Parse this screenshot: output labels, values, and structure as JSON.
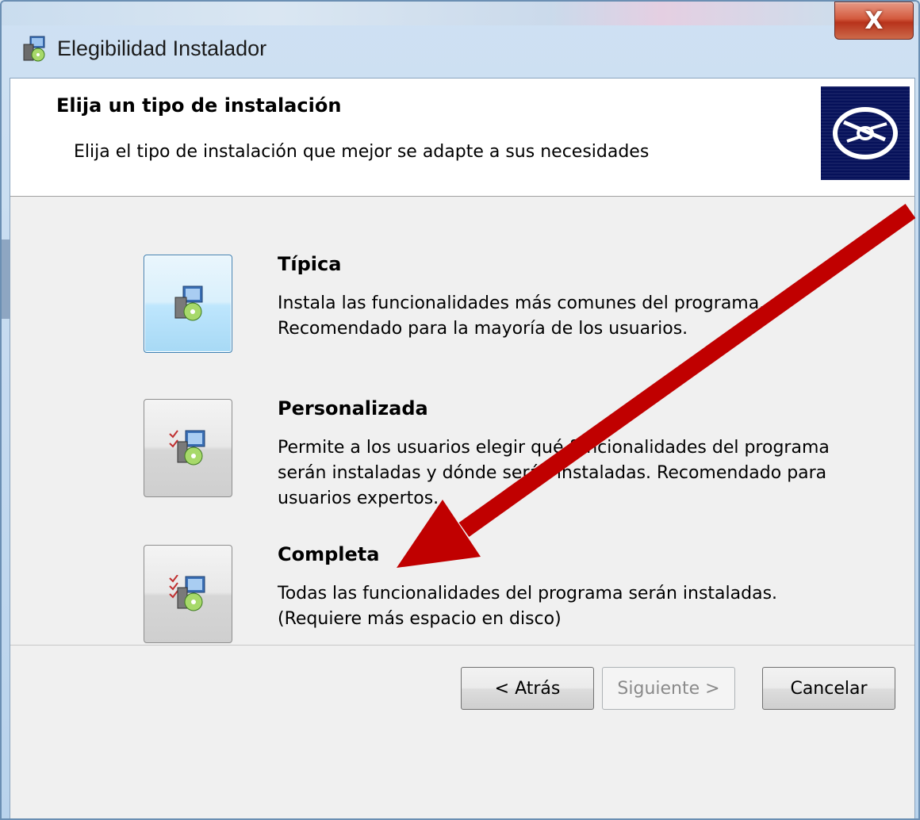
{
  "window": {
    "title": "Elegibilidad Instalador",
    "close_label": "X"
  },
  "header": {
    "title": "Elija un tipo de instalación",
    "subtitle": "Elija el tipo de instalación que mejor se adapte a sus necesidades"
  },
  "options": [
    {
      "title": "Típica",
      "description": "Instala las funcionalidades más comunes del programa. Recomendado para la mayoría de los usuarios."
    },
    {
      "title": "Personalizada",
      "description": "Permite a los usuarios elegir qué funcionalidades del programa serán instaladas y dónde serán instaladas. Recomendado para usuarios expertos."
    },
    {
      "title": "Completa",
      "description": "Todas las funcionalidades del programa serán instaladas. (Requiere más espacio en disco)"
    }
  ],
  "buttons": {
    "back": "< Atrás",
    "next": "Siguiente >",
    "cancel": "Cancelar"
  },
  "colors": {
    "annotation_arrow": "#c00000",
    "banner": "#06115a"
  }
}
